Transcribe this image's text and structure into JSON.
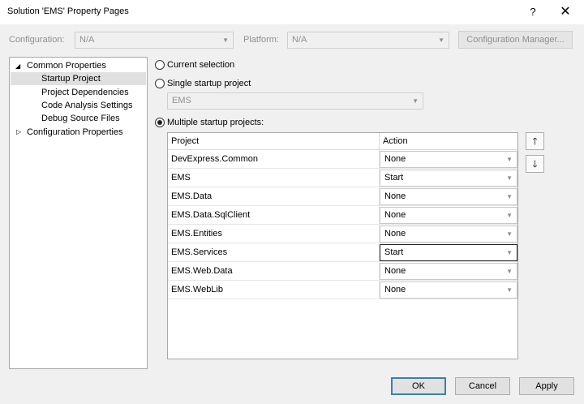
{
  "window": {
    "title": "Solution 'EMS' Property Pages",
    "help": "?",
    "close": "✕"
  },
  "config": {
    "configuration_label": "Configuration:",
    "configuration_value": "N/A",
    "platform_label": "Platform:",
    "platform_value": "N/A",
    "manager_button": "Configuration Manager..."
  },
  "tree": {
    "common": "Common Properties",
    "startup": "Startup Project",
    "deps": "Project Dependencies",
    "analysis": "Code Analysis Settings",
    "debug": "Debug Source Files",
    "configprops": "Configuration Properties"
  },
  "startup": {
    "current_selection": "Current selection",
    "single": "Single startup project",
    "single_value": "EMS",
    "multiple": "Multiple startup projects:"
  },
  "grid": {
    "col_project": "Project",
    "col_action": "Action",
    "rows": [
      {
        "project": "DevExpress.Common",
        "action": "None"
      },
      {
        "project": "EMS",
        "action": "Start"
      },
      {
        "project": "EMS.Data",
        "action": "None"
      },
      {
        "project": "EMS.Data.SqlClient",
        "action": "None"
      },
      {
        "project": "EMS.Entities",
        "action": "None"
      },
      {
        "project": "EMS.Services",
        "action": "Start"
      },
      {
        "project": "EMS.Web.Data",
        "action": "None"
      },
      {
        "project": "EMS.WebLib",
        "action": "None"
      }
    ]
  },
  "side": {
    "up": "🡑",
    "down": "🡓"
  },
  "buttons": {
    "ok": "OK",
    "cancel": "Cancel",
    "apply": "Apply"
  }
}
